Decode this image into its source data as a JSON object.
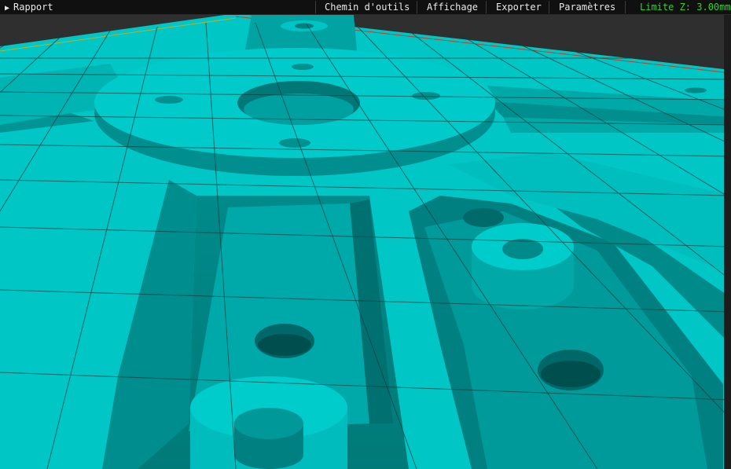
{
  "menubar": {
    "report_arrow": "▶",
    "report_label": "Rapport",
    "toolpath_label": "Chemin d'outils",
    "view_label": "Affichage",
    "export_label": "Exporter",
    "settings_label": "Paramètres",
    "z_limit_text": "Limite Z: 3.00mm"
  },
  "colors": {
    "part_top": "#00c8c8",
    "part_wall": "#008c8c",
    "pocket_floor": "#00807f",
    "grid_line": "#0b3a3a",
    "menubar_bg": "#101010",
    "z_limit": "#2fd12f"
  }
}
